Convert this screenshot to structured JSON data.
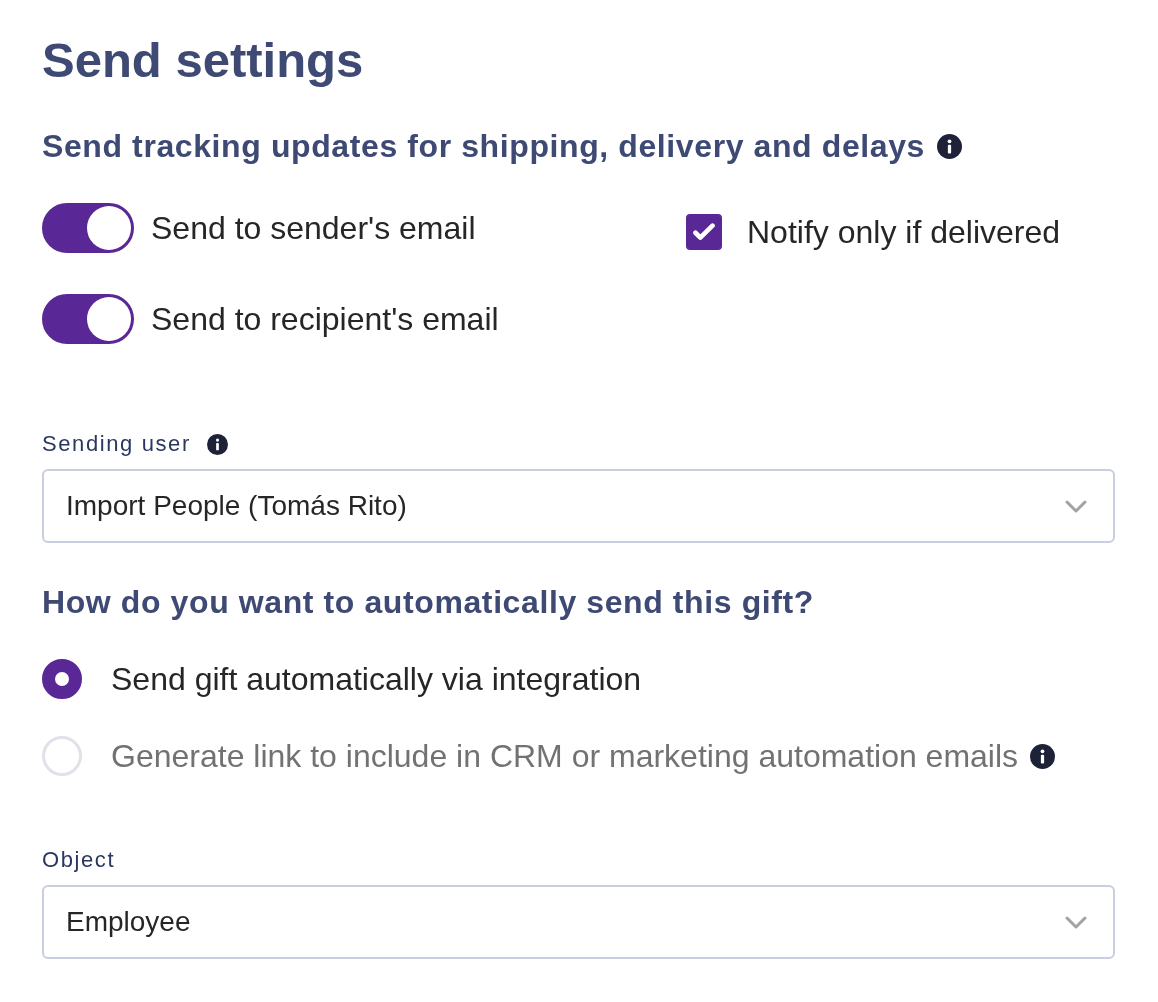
{
  "title": "Send settings",
  "tracking": {
    "heading": "Send tracking updates for shipping, delivery and delays",
    "toggles": [
      {
        "label": "Send to sender's email",
        "on": true
      },
      {
        "label": "Send to recipient's email",
        "on": true
      }
    ],
    "checkbox": {
      "label": "Notify only if delivered",
      "checked": true
    }
  },
  "sending_user": {
    "label": "Sending user",
    "value": "Import People (Tomás Rito)"
  },
  "send_method": {
    "question": "How do you want to automatically send this gift?",
    "options": [
      {
        "label": "Send gift automatically via integration",
        "selected": true,
        "disabled": false,
        "info": false
      },
      {
        "label": "Generate link to include in CRM or marketing automation emails",
        "selected": false,
        "disabled": true,
        "info": true
      }
    ]
  },
  "object": {
    "label": "Object",
    "value": "Employee"
  }
}
